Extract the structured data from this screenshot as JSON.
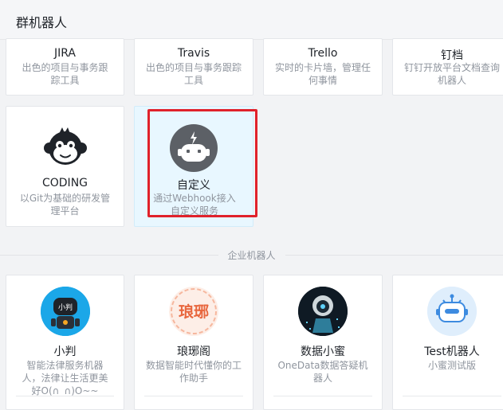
{
  "header": {
    "title": "群机器人"
  },
  "group_bots": [
    {
      "name": "JIRA",
      "desc": "出色的项目与事务跟踪工具"
    },
    {
      "name": "Travis",
      "desc": "出色的项目与事务跟踪工具"
    },
    {
      "name": "Trello",
      "desc": "实时的卡片墙，管理任何事情"
    },
    {
      "name": "钉档",
      "desc": "钉钉开放平台文档查询机器人"
    },
    {
      "name": "CODING",
      "desc": "以Git为基础的研发管理平台",
      "icon": "monkey-icon"
    },
    {
      "name": "自定义",
      "desc": "通过Webhook接入自定义服务",
      "icon": "robot-icon",
      "selected": true
    }
  ],
  "section": {
    "label": "企业机器人"
  },
  "enterprise_bots": [
    {
      "name": "小判",
      "desc": "智能法律服务机器人，法律让生活更美好O(∩_∩)O~~",
      "icon": "law-robot-icon"
    },
    {
      "name": "琅琊阁",
      "desc": "数据智能时代懂你的工作助手",
      "icon": "langya-logo-icon",
      "logo_text": "琅琊"
    },
    {
      "name": "数据小蜜",
      "desc": "OneData数据答疑机器人",
      "icon": "data-assistant-icon"
    },
    {
      "name": "Test机器人",
      "desc": "小蜜测试版",
      "icon": "test-robot-icon"
    }
  ],
  "colors": {
    "highlight": "#e0222b",
    "selected_bg": "#e8f7ff",
    "robot_grey": "#5c6066"
  }
}
